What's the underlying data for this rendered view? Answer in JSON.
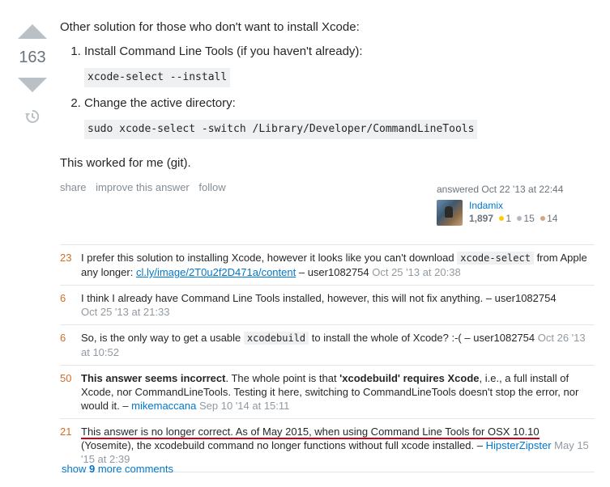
{
  "votes": {
    "count": "163"
  },
  "post": {
    "intro": "Other solution for those who don't want to install Xcode:",
    "step1": "Install Command Line Tools (if you haven't already):",
    "code1": "xcode-select --install",
    "step2": "Change the active directory:",
    "code2": "sudo xcode-select -switch /Library/Developer/CommandLineTools",
    "outro": "This worked for me (git)."
  },
  "menu": {
    "share": "share",
    "improve": "improve this answer",
    "follow": "follow"
  },
  "user": {
    "action": "answered Oct 22 '13 at 22:44",
    "name": "Indamix",
    "rep": "1,897",
    "gold": "1",
    "silver": "15",
    "bronze": "14",
    "gold_color": "#ffcc01",
    "silver_color": "#b4b8bc",
    "bronze_color": "#d1a684"
  },
  "comments": [
    {
      "score": "23",
      "text_a": "I prefer this solution to installing Xcode, however it looks like you can't download ",
      "code": "xcode-select",
      "text_b": " from Apple any longer: ",
      "link": "cl.ly/image/2T0u2f2D471a/content",
      "sep": " – ",
      "user": "user1082754",
      "date": "Oct 25 '13 at 20:38"
    },
    {
      "score": "6",
      "text": "I think I already have Command Line Tools installed, however, this will not fix anything.",
      "sep": " – ",
      "user": "user1082754",
      "date": "Oct 25 '13 at 21:33"
    },
    {
      "score": "6",
      "text_a": "So, is the only way to get a usable ",
      "code": "xcodebuild",
      "text_b": " to install the whole of Xcode? :-(",
      "sep": " – ",
      "user": "user1082754",
      "date": "Oct 26 '13 at 10:52"
    },
    {
      "score": "50",
      "bold_a": "This answer seems incorrect",
      "text_a": ". The whole point is that ",
      "bold_b": "'xcodebuild' requires Xcode",
      "text_b": ", i.e., a full install of Xcode, nor CommandLineTools. Testing it here, switching to CommandLineTools doesn't stop the error, nor would it.",
      "sep": " – ",
      "user": "mikemaccana",
      "date": "Sep 10 '14 at 15:11"
    },
    {
      "score": "21",
      "underlined": "This answer is no longer correct. As of May 2015, when using Command Line Tools for OSX 10.10",
      "text": " (Yosemite), the xcodebuild command no longer functions without full xcode installed.",
      "sep": " – ",
      "user": "HipsterZipster",
      "date": "May 15 '15 at 2:39"
    }
  ],
  "show_more": {
    "prefix": "show ",
    "count": "9",
    "suffix": " more comments"
  }
}
